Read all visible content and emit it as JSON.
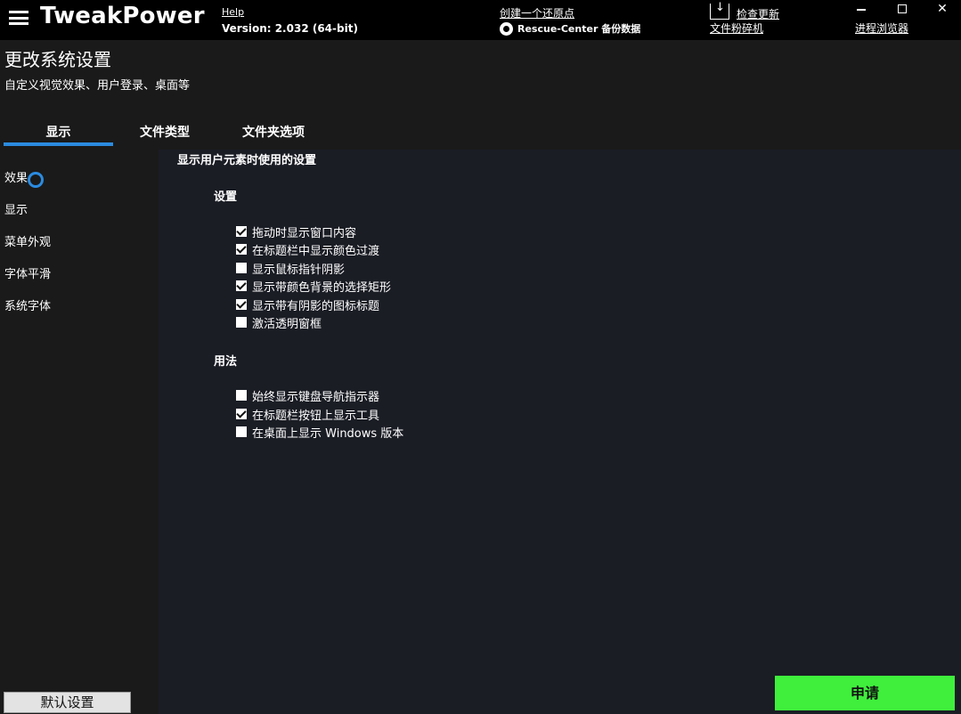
{
  "header": {
    "brand": "TweakPower",
    "help": "Help",
    "version": "Version: 2.032 (64-bit)",
    "restore_point": "创建一个还原点",
    "rescue_center": "Rescue-Center 备份数据",
    "check_update": "检查更新",
    "file_shredder": "文件粉碎机",
    "process_browser": "进程浏览器",
    "win_close": "✕"
  },
  "page": {
    "title": "更改系统设置",
    "subtitle": "自定义视觉效果、用户登录、桌面等"
  },
  "tabs": [
    {
      "label": "显示",
      "active": true
    },
    {
      "label": "文件类型",
      "active": false
    },
    {
      "label": "文件夹选项",
      "active": false
    }
  ],
  "sidebar": {
    "items": [
      {
        "label": "效果",
        "selected": true
      },
      {
        "label": "显示"
      },
      {
        "label": "菜单外观"
      },
      {
        "label": "字体平滑"
      },
      {
        "label": "系统字体"
      }
    ]
  },
  "main": {
    "heading": "显示用户元素时使用的设置",
    "groups": [
      {
        "title": "设置",
        "options": [
          {
            "label": "拖动时显示窗口内容",
            "checked": true
          },
          {
            "label": "在标题栏中显示颜色过渡",
            "checked": true
          },
          {
            "label": "显示鼠标指针阴影",
            "checked": false
          },
          {
            "label": "显示带颜色背景的选择矩形",
            "checked": true
          },
          {
            "label": "显示带有阴影的图标标题",
            "checked": true
          },
          {
            "label": "激活透明窗框",
            "checked": false
          }
        ]
      },
      {
        "title": "用法",
        "options": [
          {
            "label": "始终显示键盘导航指示器",
            "checked": false
          },
          {
            "label": "在标题栏按钮上显示工具",
            "checked": true
          },
          {
            "label": "在桌面上显示 Windows 版本",
            "checked": false
          }
        ]
      }
    ]
  },
  "footer": {
    "defaults": "默认设置",
    "apply": "申请"
  },
  "colors": {
    "accent": "#2b8be0",
    "apply": "#3fef3c",
    "panel": "#1b1d25"
  }
}
